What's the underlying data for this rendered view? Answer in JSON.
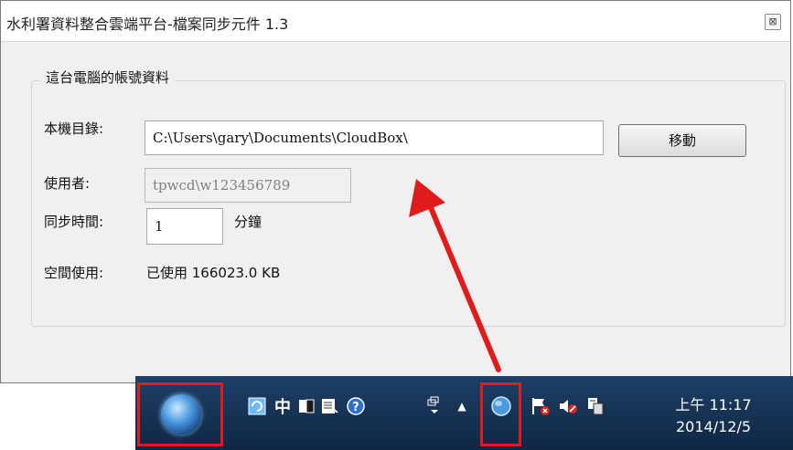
{
  "window": {
    "title": "水利署資料整合雲端平台-檔案同步元件 1.3",
    "close_label": "⊠"
  },
  "group": {
    "title": "這台電腦的帳號資料"
  },
  "form": {
    "dir_label": "本機目錄:",
    "dir_value": "C:\\Users\\gary\\Documents\\CloudBox\\",
    "move_button": "移動",
    "user_label": "使用者:",
    "user_value": "tpwcd\\w123456789",
    "sync_label": "同步時間:",
    "sync_value": "1",
    "sync_unit": "分鐘",
    "space_label": "空間使用:",
    "space_value": "已使用 166023.0 KB"
  },
  "taskbar": {
    "icons": [
      "sync-icon",
      "ime-chinese-icon",
      "ime-fullwidth-icon",
      "ime-keyboard-icon",
      "help-icon",
      "ime-options-icon",
      "show-hidden-icons-arrow",
      "cloudbox-tray-icon",
      "action-center-flag-icon",
      "volume-muted-icon",
      "network-icon"
    ],
    "ime_label": "中",
    "clock_time": "上午 11:17",
    "clock_date": "2014/12/5"
  },
  "colors": {
    "annotation_red": "#e01b1b",
    "taskbar": "#163559"
  }
}
